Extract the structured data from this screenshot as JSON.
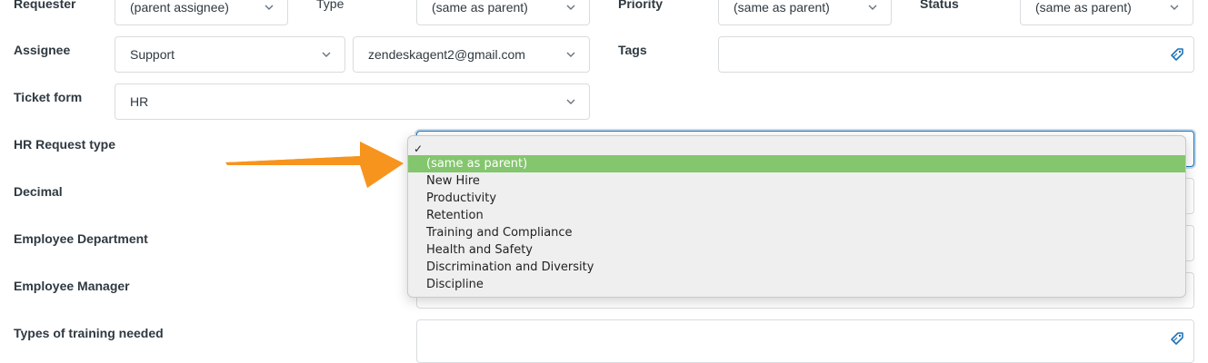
{
  "labels": {
    "requester": "Requester",
    "type": "Type",
    "priority": "Priority",
    "status": "Status",
    "assignee": "Assignee",
    "tags": "Tags",
    "ticket_form": "Ticket form",
    "hr_request_type": "HR Request type",
    "decimal": "Decimal",
    "employee_department": "Employee Department",
    "employee_manager": "Employee Manager",
    "types_of_training": "Types of training needed"
  },
  "fields": {
    "requester_value": "(parent assignee)",
    "type_value": "(same as parent)",
    "priority_value": "(same as parent)",
    "status_value": "(same as parent)",
    "assignee_group": "Support",
    "assignee_agent": "zendeskagent2@gmail.com",
    "ticket_form_value": "HR"
  },
  "dropdown": {
    "check_mark": "✓",
    "options": [
      "",
      "(same as parent)",
      "New Hire",
      "Productivity",
      "Retention",
      "Training and Compliance",
      "Health and Safety",
      "Discrimination and Diversity",
      "Discipline"
    ],
    "selected_index": 1,
    "highlight_color": "#84c66d"
  },
  "colors": {
    "focus_border": "#1f73b7",
    "arrow": "#f7941d",
    "icon_blue": "#1f73b7"
  },
  "icons": {
    "chevron": "chevron-down-icon",
    "tag": "tag-icon",
    "arrow": "pointer-arrow"
  }
}
